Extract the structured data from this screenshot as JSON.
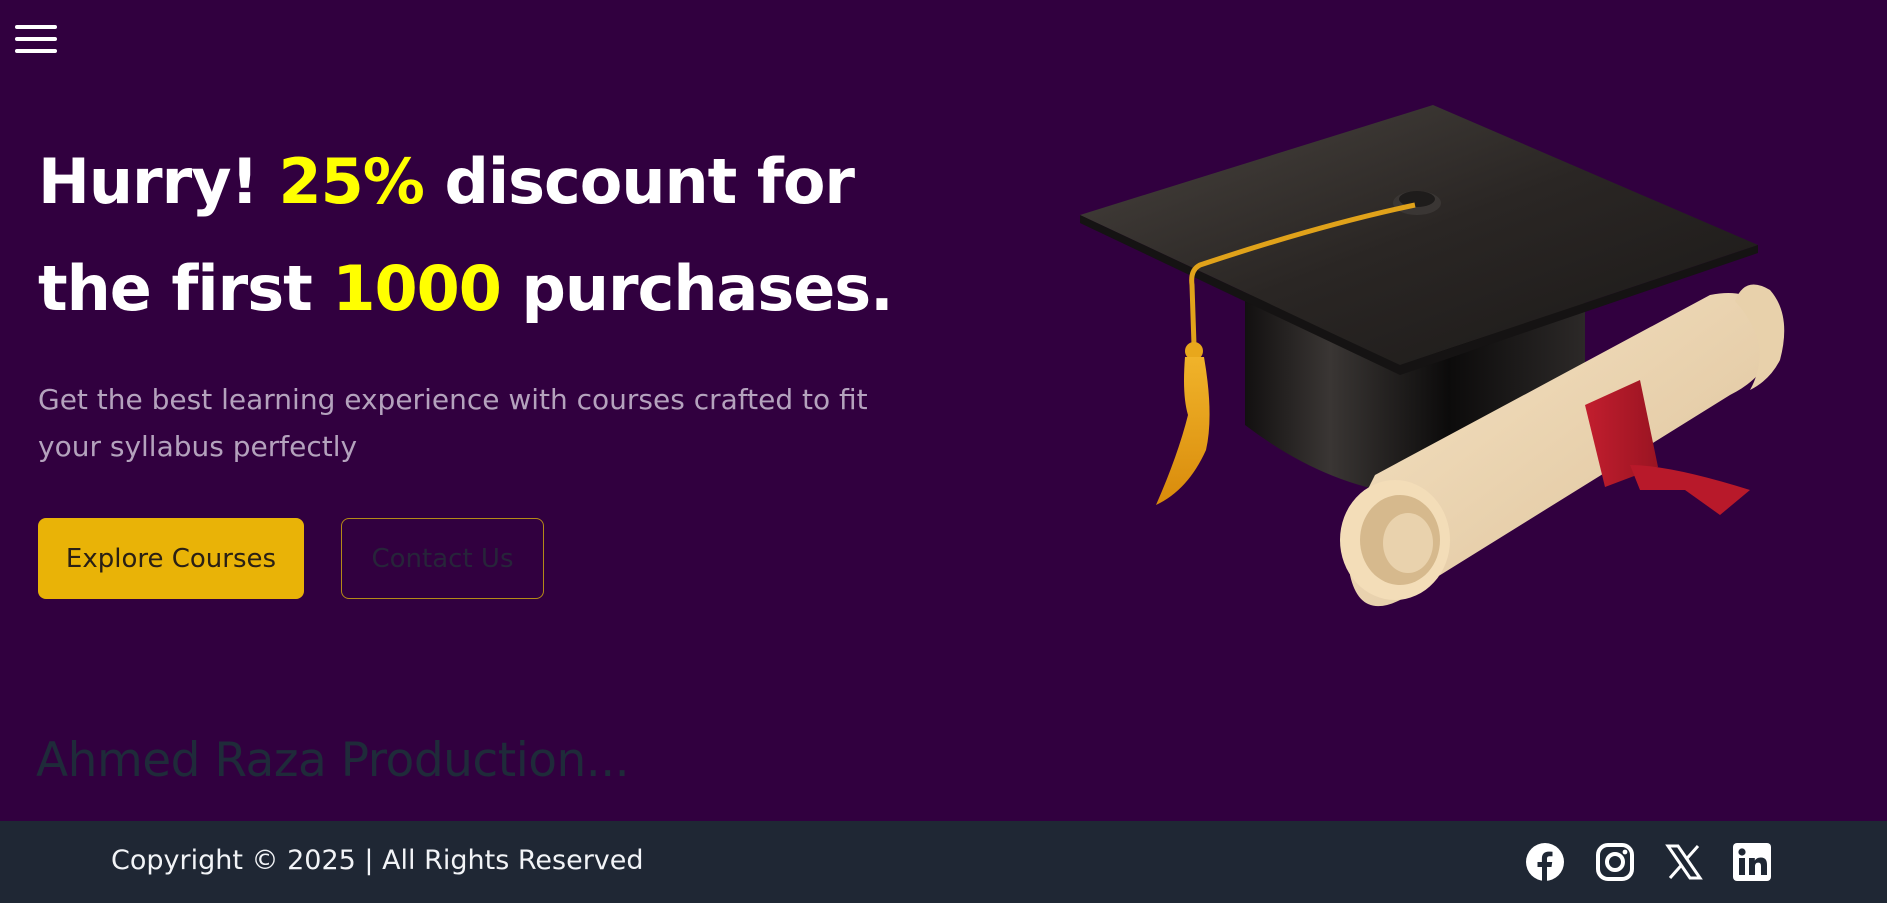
{
  "nav": {
    "menu_icon": "hamburger-menu-icon"
  },
  "hero": {
    "title": {
      "part1": "Hurry! ",
      "highlight1": "25%",
      "part2": " discount for",
      "part3": "the first ",
      "highlight2": "1000",
      "part4": " purchases."
    },
    "subtitle": "Get the best learning experience with courses crafted to fit your syllabus perfectly",
    "primary_button": "Explore Courses",
    "secondary_button": "Contact Us",
    "illustration": "graduation-cap-and-diploma-illustration"
  },
  "watermark": "Ahmed Raza Production...",
  "footer": {
    "copyright": "Copyright © 2025 | All Rights Reserved",
    "social_icons": [
      "facebook-icon",
      "instagram-icon",
      "x-icon",
      "linkedin-icon"
    ]
  },
  "colors": {
    "background": "#31003f",
    "highlight": "#ffff00",
    "accent": "#e9b307",
    "footer": "#1f2734"
  }
}
